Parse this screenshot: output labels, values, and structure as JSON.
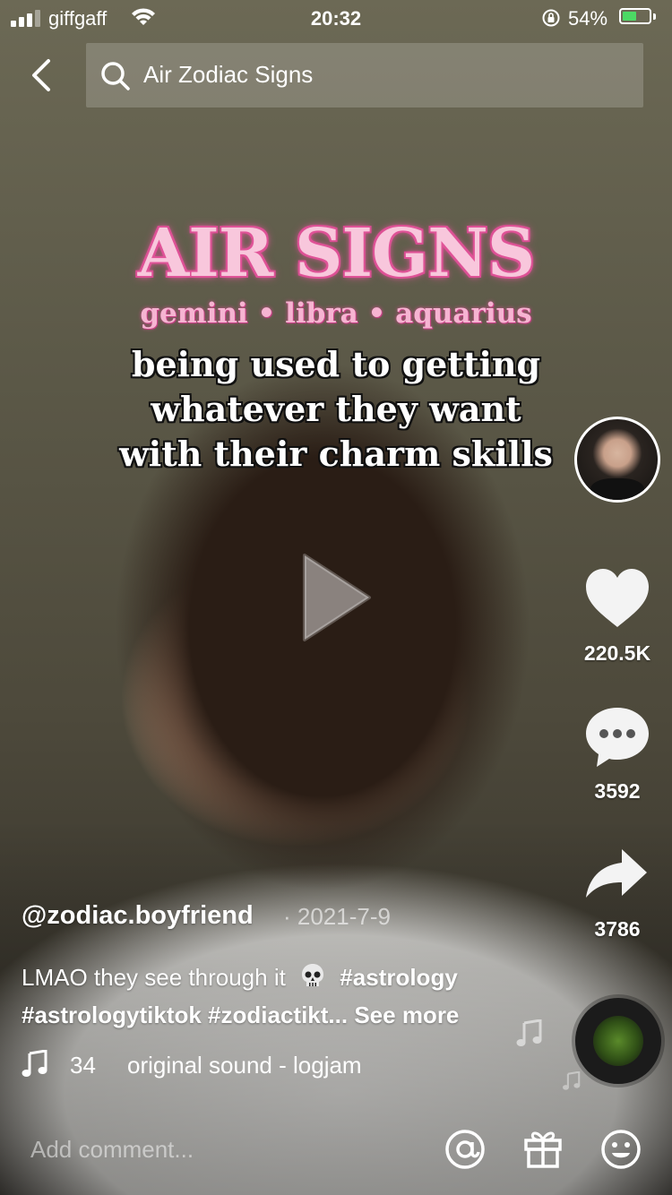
{
  "status_bar": {
    "carrier": "giffgaff",
    "time": "20:32",
    "battery_percent": "54%",
    "battery_level": 0.54,
    "battery_color": "#4cd964"
  },
  "header": {
    "back_icon": "chevron-left-icon",
    "search_icon": "search-icon",
    "search_query": "Air Zodiac Signs"
  },
  "video_overlay": {
    "headline": "AIR SIGNS",
    "subline": "gemini • libra • aquarius",
    "caption_lines": [
      "being used to getting",
      "whatever they want",
      "with their charm skills"
    ],
    "accent_pink": "#f8c7dc"
  },
  "right_rail": {
    "likes": "220.5K",
    "comments": "3592",
    "shares": "3786"
  },
  "post": {
    "username": "@zodiac.boyfriend",
    "date": "· 2021-7-9",
    "description_text": "LMAO they see through it",
    "description_emoji": "skull",
    "hashtag_1": "#astrology",
    "hashtags_line2": "#astrologytiktok #zodiactikt...",
    "see_more": "See more",
    "music_count": "34",
    "music_title": "original sound - logjam"
  },
  "comment_bar": {
    "placeholder": "Add comment...",
    "icons": [
      "at-icon",
      "gift-icon",
      "emoji-icon"
    ]
  }
}
